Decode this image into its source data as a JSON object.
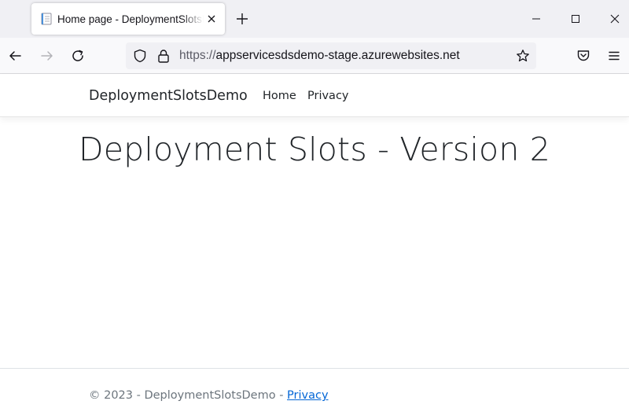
{
  "browser": {
    "tab_title": "Home page - DeploymentSlotsDemo",
    "url_scheme": "https://",
    "url_host": "appservicesdsdemo-stage.azurewebsites.net",
    "icons": [
      "favicon-page-icon",
      "tab-close-icon",
      "new-tab-icon",
      "minimize-icon",
      "maximize-icon",
      "window-close-icon",
      "back-arrow-icon",
      "forward-arrow-icon",
      "reload-icon",
      "shield-icon",
      "lock-icon",
      "bookmark-star-icon",
      "pocket-icon",
      "menu-icon"
    ]
  },
  "site": {
    "brand": "DeploymentSlotsDemo",
    "nav": [
      {
        "label": "Home"
      },
      {
        "label": "Privacy"
      }
    ],
    "heading": "Deployment Slots - Version 2",
    "footer": {
      "text": "© 2023 - DeploymentSlotsDemo - ",
      "link": "Privacy"
    }
  },
  "colors": {
    "link": "#0366d6",
    "text": "#212529",
    "muted": "#6c757d",
    "chrome_bg": "#f0f0f4"
  }
}
